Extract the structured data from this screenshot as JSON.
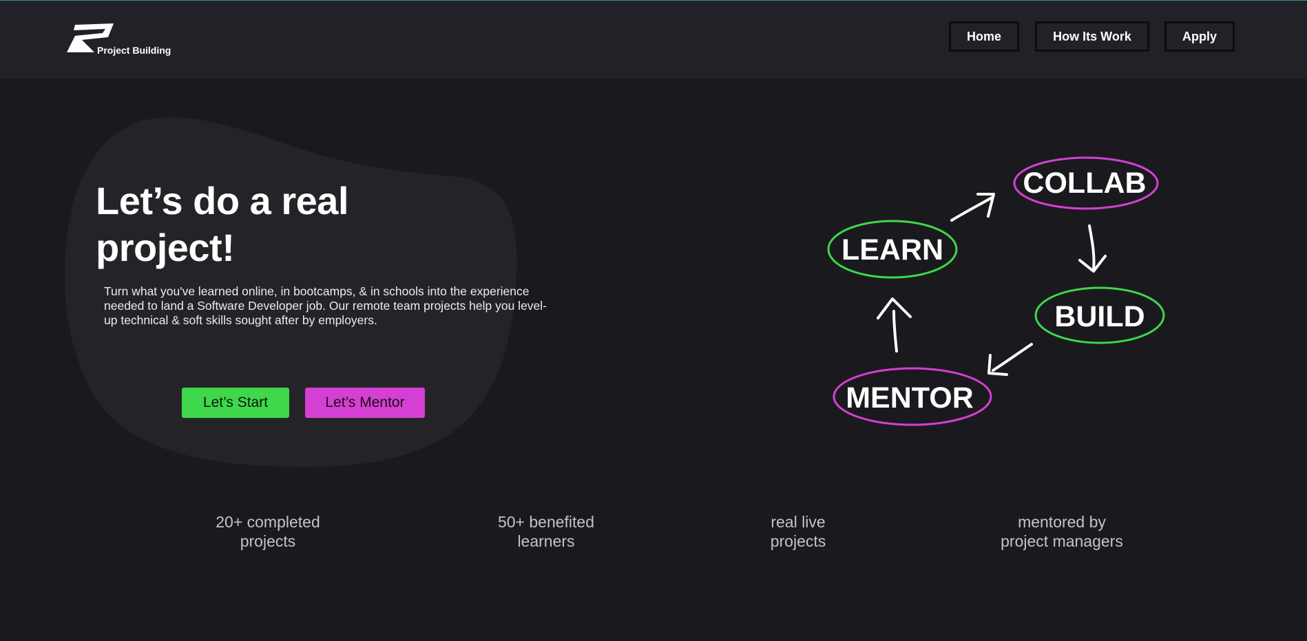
{
  "header": {
    "logo_text": "Project Building",
    "nav": [
      {
        "label": "Home"
      },
      {
        "label": "How Its Work"
      },
      {
        "label": "Apply"
      }
    ]
  },
  "hero": {
    "title": "Let’s do a real project!",
    "description": "Turn what you've learned online, in bootcamps, & in schools into the experience needed to land a Software Developer job. Our remote team projects help you level-up technical & soft skills sought after by employers.",
    "start_label": "Let’s Start",
    "mentor_label": "Let’s Mentor"
  },
  "diagram": {
    "learn": "LEARN",
    "collab": "COLLAB",
    "build": "BUILD",
    "mentor": "MENTOR"
  },
  "stats": [
    {
      "line1": "20+ completed",
      "line2": "projects"
    },
    {
      "line1": "50+ benefited",
      "line2": "learners"
    },
    {
      "line1": "real live",
      "line2": "projects"
    },
    {
      "line1": "mentored by",
      "line2": "project managers"
    }
  ],
  "colors": {
    "green": "#3ed84a",
    "magenta": "#d53fd3",
    "background": "#1a1a1e",
    "header": "#212227"
  }
}
